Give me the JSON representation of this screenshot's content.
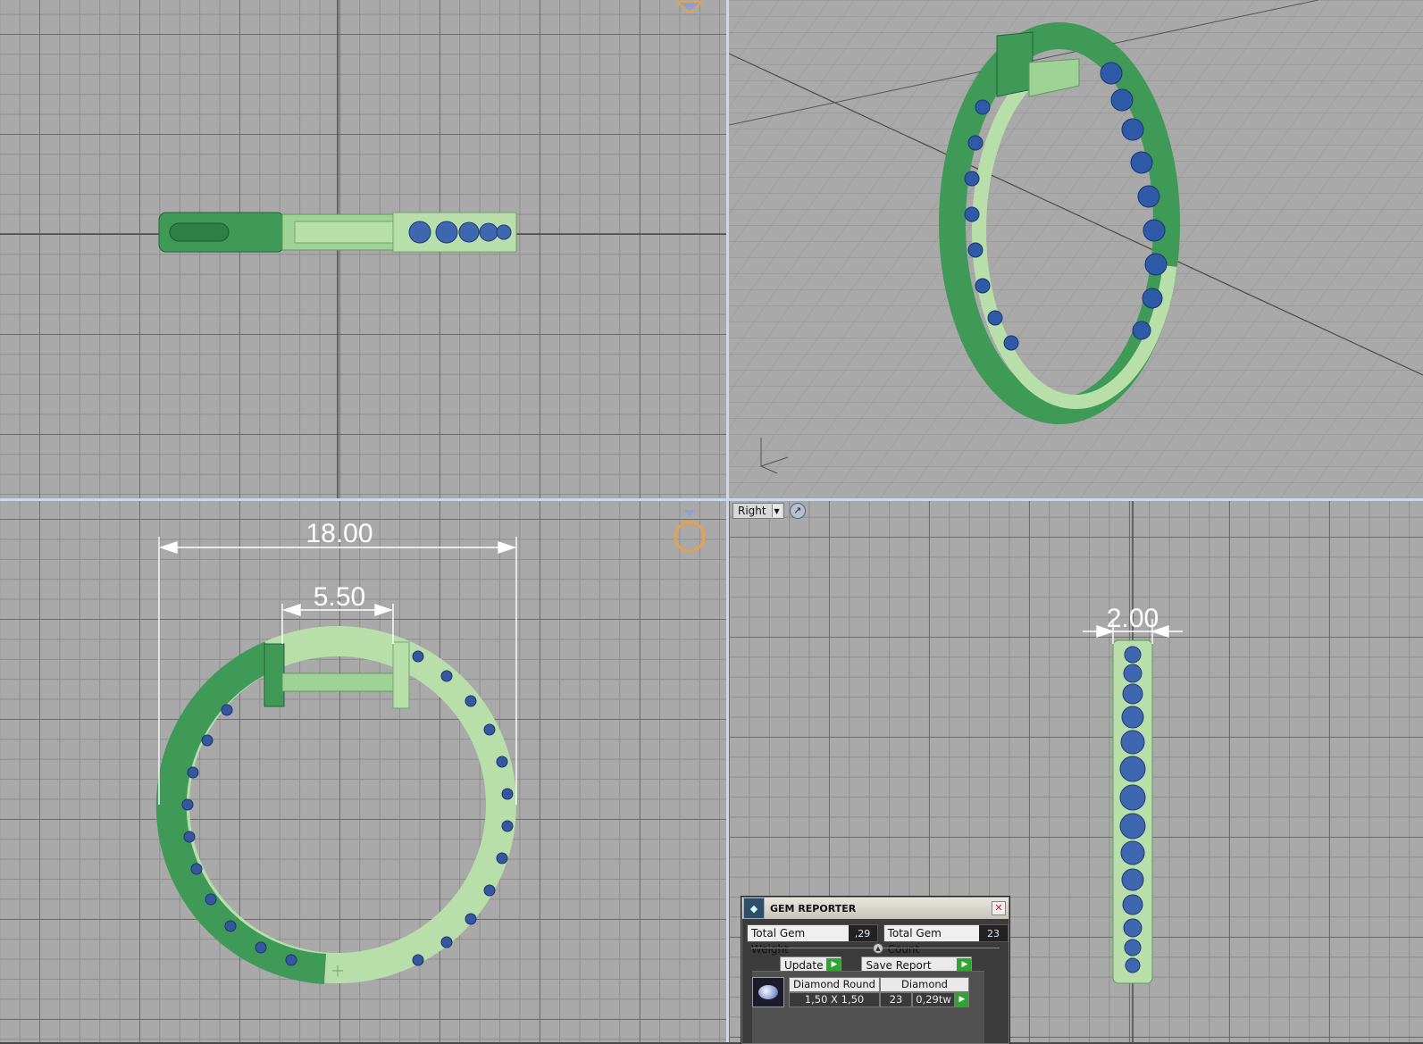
{
  "viewports": {
    "bottom_left": {
      "dimensions": {
        "outer_width": "18.00",
        "gap_width": "5.50"
      }
    },
    "bottom_right": {
      "view_selector": {
        "value": "Right"
      },
      "dimensions": {
        "thickness": "2.00"
      }
    }
  },
  "gem_reporter": {
    "title": "GEM REPORTER",
    "total_weight_label": "Total Gem Weight",
    "total_weight_value": ",29",
    "total_count_label": "Total Gem Count",
    "total_count_value": "23",
    "update_label": "Update",
    "save_report_label": "Save Report",
    "items": [
      {
        "type": "Diamond Round",
        "size": "1,50 X 1,50",
        "material": "Diamond",
        "count": "23",
        "weight": "0,29tw"
      }
    ]
  },
  "colors": {
    "metal_dark": "#3f9a57",
    "metal_light": "#b8dfaa",
    "gem_blue": "#3f67b0",
    "gizmo_orange": "#e6a14a",
    "divider": "#c9d8ec",
    "grid_bg": "#a9a9a9"
  }
}
